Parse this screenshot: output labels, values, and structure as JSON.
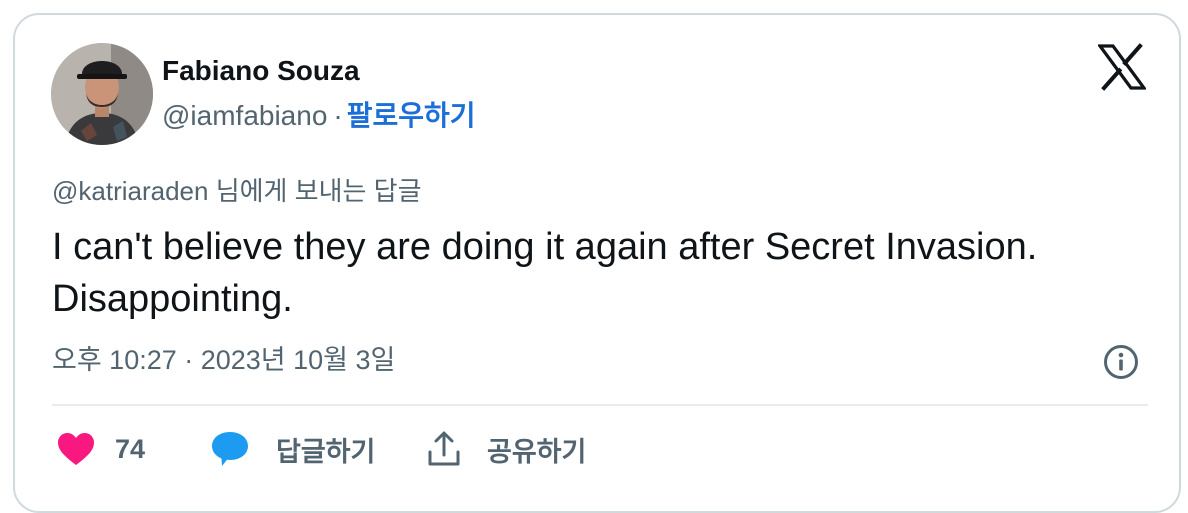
{
  "author": {
    "display_name": "Fabiano Souza",
    "handle": "@iamfabiano",
    "separator": "·",
    "follow_label": "팔로우하기"
  },
  "tweet": {
    "reply_to": "@katriaraden 님에게 보내는 답글",
    "text": "I can't believe they are doing it again after Secret Invasion. Disappointing.",
    "timestamp": "오후 10:27 · 2023년 10월 3일"
  },
  "actions": {
    "like_count": "74",
    "reply_label": "답글하기",
    "share_label": "공유하기"
  },
  "colors": {
    "like": "#f91880",
    "reply": "#1d9bf0",
    "follow": "#1d6fd8",
    "secondary_text": "#536471"
  },
  "icons": {
    "platform": "x-logo-icon",
    "info": "info-icon",
    "like": "heart-icon",
    "reply": "speech-bubble-icon",
    "share": "share-icon"
  }
}
